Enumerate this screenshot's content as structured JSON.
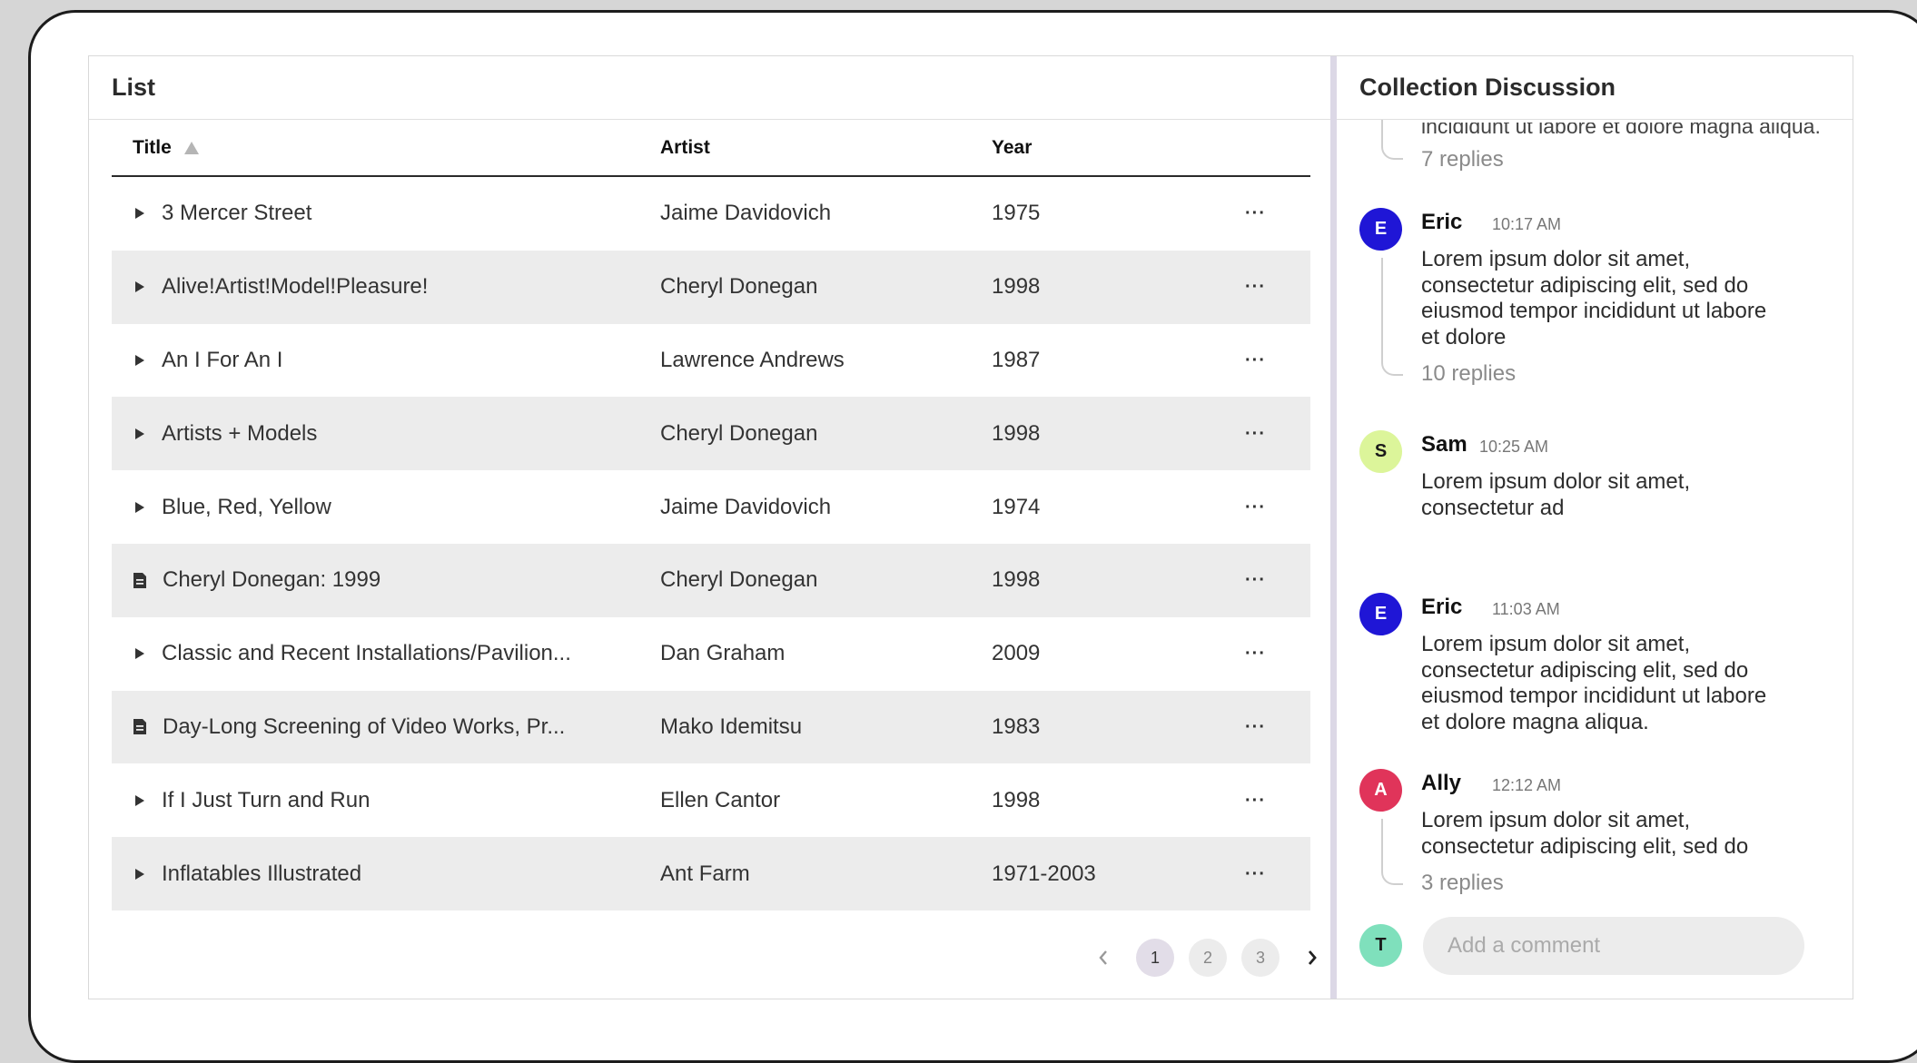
{
  "list": {
    "title": "List",
    "columns": {
      "title": "Title",
      "artist": "Artist",
      "year": "Year"
    },
    "rows": [
      {
        "title": "3 Mercer Street",
        "artist": "Jaime Davidovich",
        "year": "1975",
        "icon": "expand-icon"
      },
      {
        "title": "Alive!Artist!Model!Pleasure!",
        "artist": "Cheryl Donegan",
        "year": "1998",
        "icon": "expand-icon"
      },
      {
        "title": "An I For An I",
        "artist": "Lawrence Andrews",
        "year": "1987",
        "icon": "expand-icon"
      },
      {
        "title": "Artists + Models",
        "artist": "Cheryl Donegan",
        "year": "1998",
        "icon": "expand-icon"
      },
      {
        "title": "Blue, Red, Yellow",
        "artist": "Jaime Davidovich",
        "year": "1974",
        "icon": "expand-icon"
      },
      {
        "title": "Cheryl Donegan: 1999",
        "artist": "Cheryl Donegan",
        "year": "1998",
        "icon": "document-icon"
      },
      {
        "title": "Classic and Recent Installations/Pavilion...",
        "artist": "Dan Graham",
        "year": "2009",
        "icon": "expand-icon"
      },
      {
        "title": "Day-Long Screening of Video Works, Pr...",
        "artist": "Mako Idemitsu",
        "year": "1983",
        "icon": "document-icon"
      },
      {
        "title": "If I Just Turn and Run",
        "artist": "Ellen Cantor",
        "year": "1998",
        "icon": "expand-icon"
      },
      {
        "title": "Inflatables Illustrated",
        "artist": "Ant Farm",
        "year": "1971-2003",
        "icon": "expand-icon"
      }
    ],
    "more_label": "···",
    "pagination": {
      "pages": [
        "1",
        "2",
        "3"
      ],
      "current": "1"
    }
  },
  "discussion": {
    "title": "Collection Discussion",
    "cut_text": "incididunt ut labore et dolore magna aliqua.",
    "top_replies": "7 replies",
    "comments": [
      {
        "initial": "E",
        "author": "Eric",
        "time": "10:17 AM",
        "lines": [
          "Lorem ipsum dolor sit amet,",
          "consectetur adipiscing elit, sed do",
          "eiusmod tempor incididunt ut labore",
          "et dolore"
        ],
        "replies": "10 replies",
        "color": "#1f16d6",
        "text_color": "#ffffff"
      },
      {
        "initial": "S",
        "author": "Sam",
        "time": "10:25 AM",
        "lines": [
          "Lorem ipsum dolor sit amet,",
          "consectetur ad"
        ],
        "replies": "",
        "color": "#dcf59a",
        "text_color": "#1a1a1a"
      },
      {
        "initial": "E",
        "author": "Eric",
        "time": "11:03 AM",
        "lines": [
          "Lorem ipsum dolor sit amet,",
          "consectetur adipiscing elit, sed do",
          "eiusmod tempor incididunt ut labore",
          "et dolore magna aliqua."
        ],
        "replies": "",
        "color": "#1f16d6",
        "text_color": "#ffffff"
      },
      {
        "initial": "A",
        "author": "Ally",
        "time": "12:12 AM",
        "lines": [
          "Lorem ipsum dolor sit amet,",
          "consectetur adipiscing elit, sed do"
        ],
        "replies": "3 replies",
        "color": "#e0345a",
        "text_color": "#ffffff"
      }
    ],
    "composer": {
      "initial": "T",
      "placeholder": "Add a comment",
      "color": "#7fe0bc"
    }
  }
}
